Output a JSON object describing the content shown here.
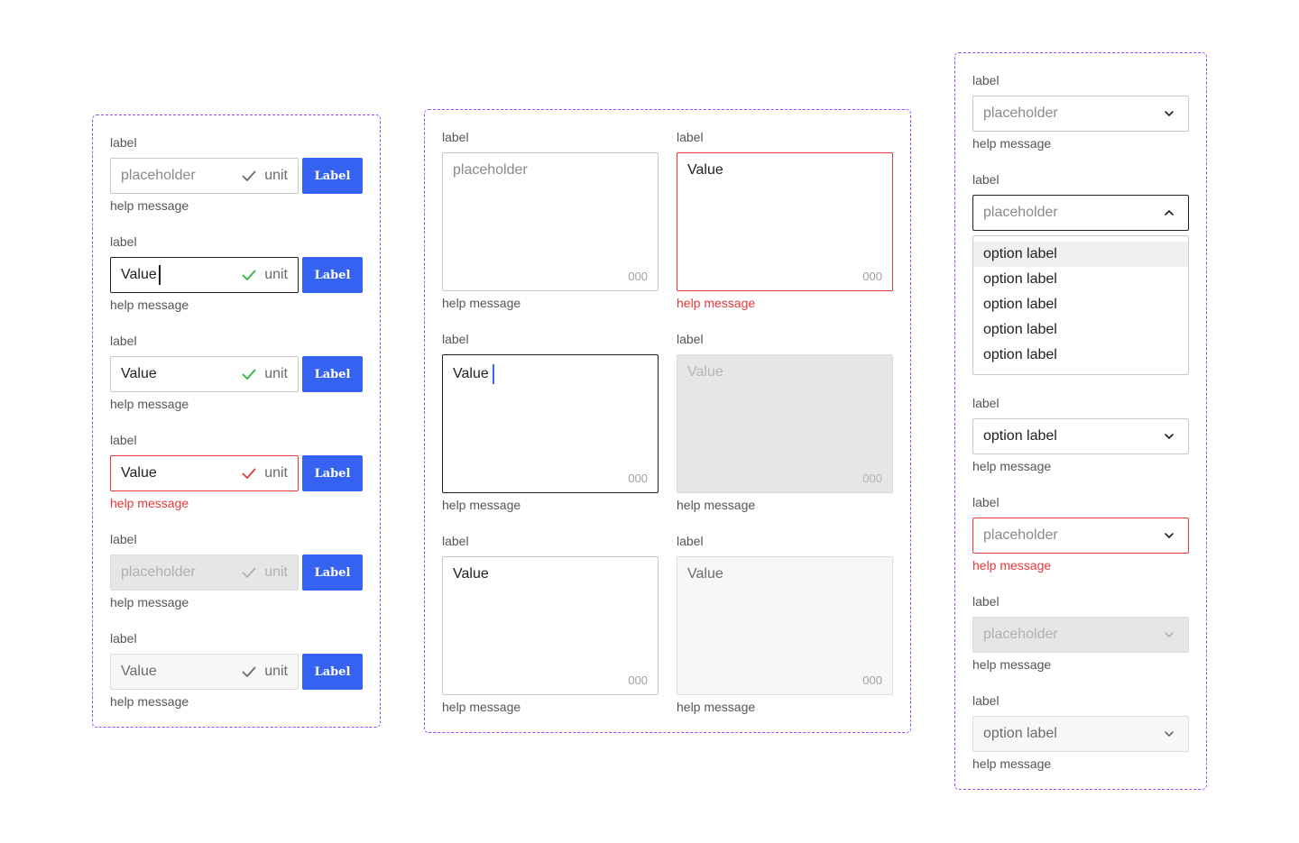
{
  "colors": {
    "frame_border": "#9747ff",
    "accent": "#3562f1",
    "error": "#e5383b",
    "success_check": "#2fb344",
    "neutral_check": "#6b6b6b",
    "disabled_bg": "#e6e6e6"
  },
  "input_group": {
    "rows": [
      {
        "label": "label",
        "value": "placeholder",
        "unit": "unit",
        "button": "Label",
        "help": "help message",
        "state": "default",
        "check": "check-icon-neutral"
      },
      {
        "label": "label",
        "value": "Value",
        "unit": "unit",
        "button": "Label",
        "help": "help message",
        "state": "focus",
        "check": "check-icon-success"
      },
      {
        "label": "label",
        "value": "Value",
        "unit": "unit",
        "button": "Label",
        "help": "help message",
        "state": "filled",
        "check": "check-icon-success"
      },
      {
        "label": "label",
        "value": "Value",
        "unit": "unit",
        "button": "Label",
        "help": "help message",
        "state": "error",
        "check": "check-icon-error"
      },
      {
        "label": "label",
        "value": "placeholder",
        "unit": "unit",
        "button": "Label",
        "help": "help message",
        "state": "disabled",
        "check": "check-icon-disabled"
      },
      {
        "label": "label",
        "value": "Value",
        "unit": "unit",
        "button": "Label",
        "help": "help message",
        "state": "readonly",
        "check": "check-icon-neutral"
      }
    ]
  },
  "textarea_group": {
    "items": [
      {
        "label": "label",
        "value": "placeholder",
        "count": "000",
        "help": "help message",
        "state": "default"
      },
      {
        "label": "label",
        "value": "Value",
        "count": "000",
        "help": "help message",
        "state": "error"
      },
      {
        "label": "label",
        "value": "Value",
        "count": "000",
        "help": "help message",
        "state": "focus"
      },
      {
        "label": "label",
        "value": "Value",
        "count": "000",
        "help": "help message",
        "state": "disabled"
      },
      {
        "label": "label",
        "value": "Value",
        "count": "000",
        "help": "help message",
        "state": "filled"
      },
      {
        "label": "label",
        "value": "Value",
        "count": "000",
        "help": "help message",
        "state": "readonly"
      }
    ]
  },
  "select_group": {
    "items": [
      {
        "label": "label",
        "value": "placeholder",
        "help": "help message",
        "state": "default",
        "chevron": "chevron-down-icon"
      },
      {
        "label": "label",
        "value": "placeholder",
        "state": "open",
        "chevron": "chevron-up-icon",
        "options": [
          "option label",
          "option label",
          "option label",
          "option label",
          "option label"
        ]
      },
      {
        "label": "label",
        "value": "option label",
        "help": "help message",
        "state": "filled",
        "chevron": "chevron-down-icon"
      },
      {
        "label": "label",
        "value": "placeholder",
        "help": "help message",
        "state": "error",
        "chevron": "chevron-down-icon"
      },
      {
        "label": "label",
        "value": "placeholder",
        "help": "help message",
        "state": "disabled",
        "chevron": "chevron-down-icon"
      },
      {
        "label": "label",
        "value": "option label",
        "help": "help message",
        "state": "readonly",
        "chevron": "chevron-down-icon"
      }
    ]
  }
}
